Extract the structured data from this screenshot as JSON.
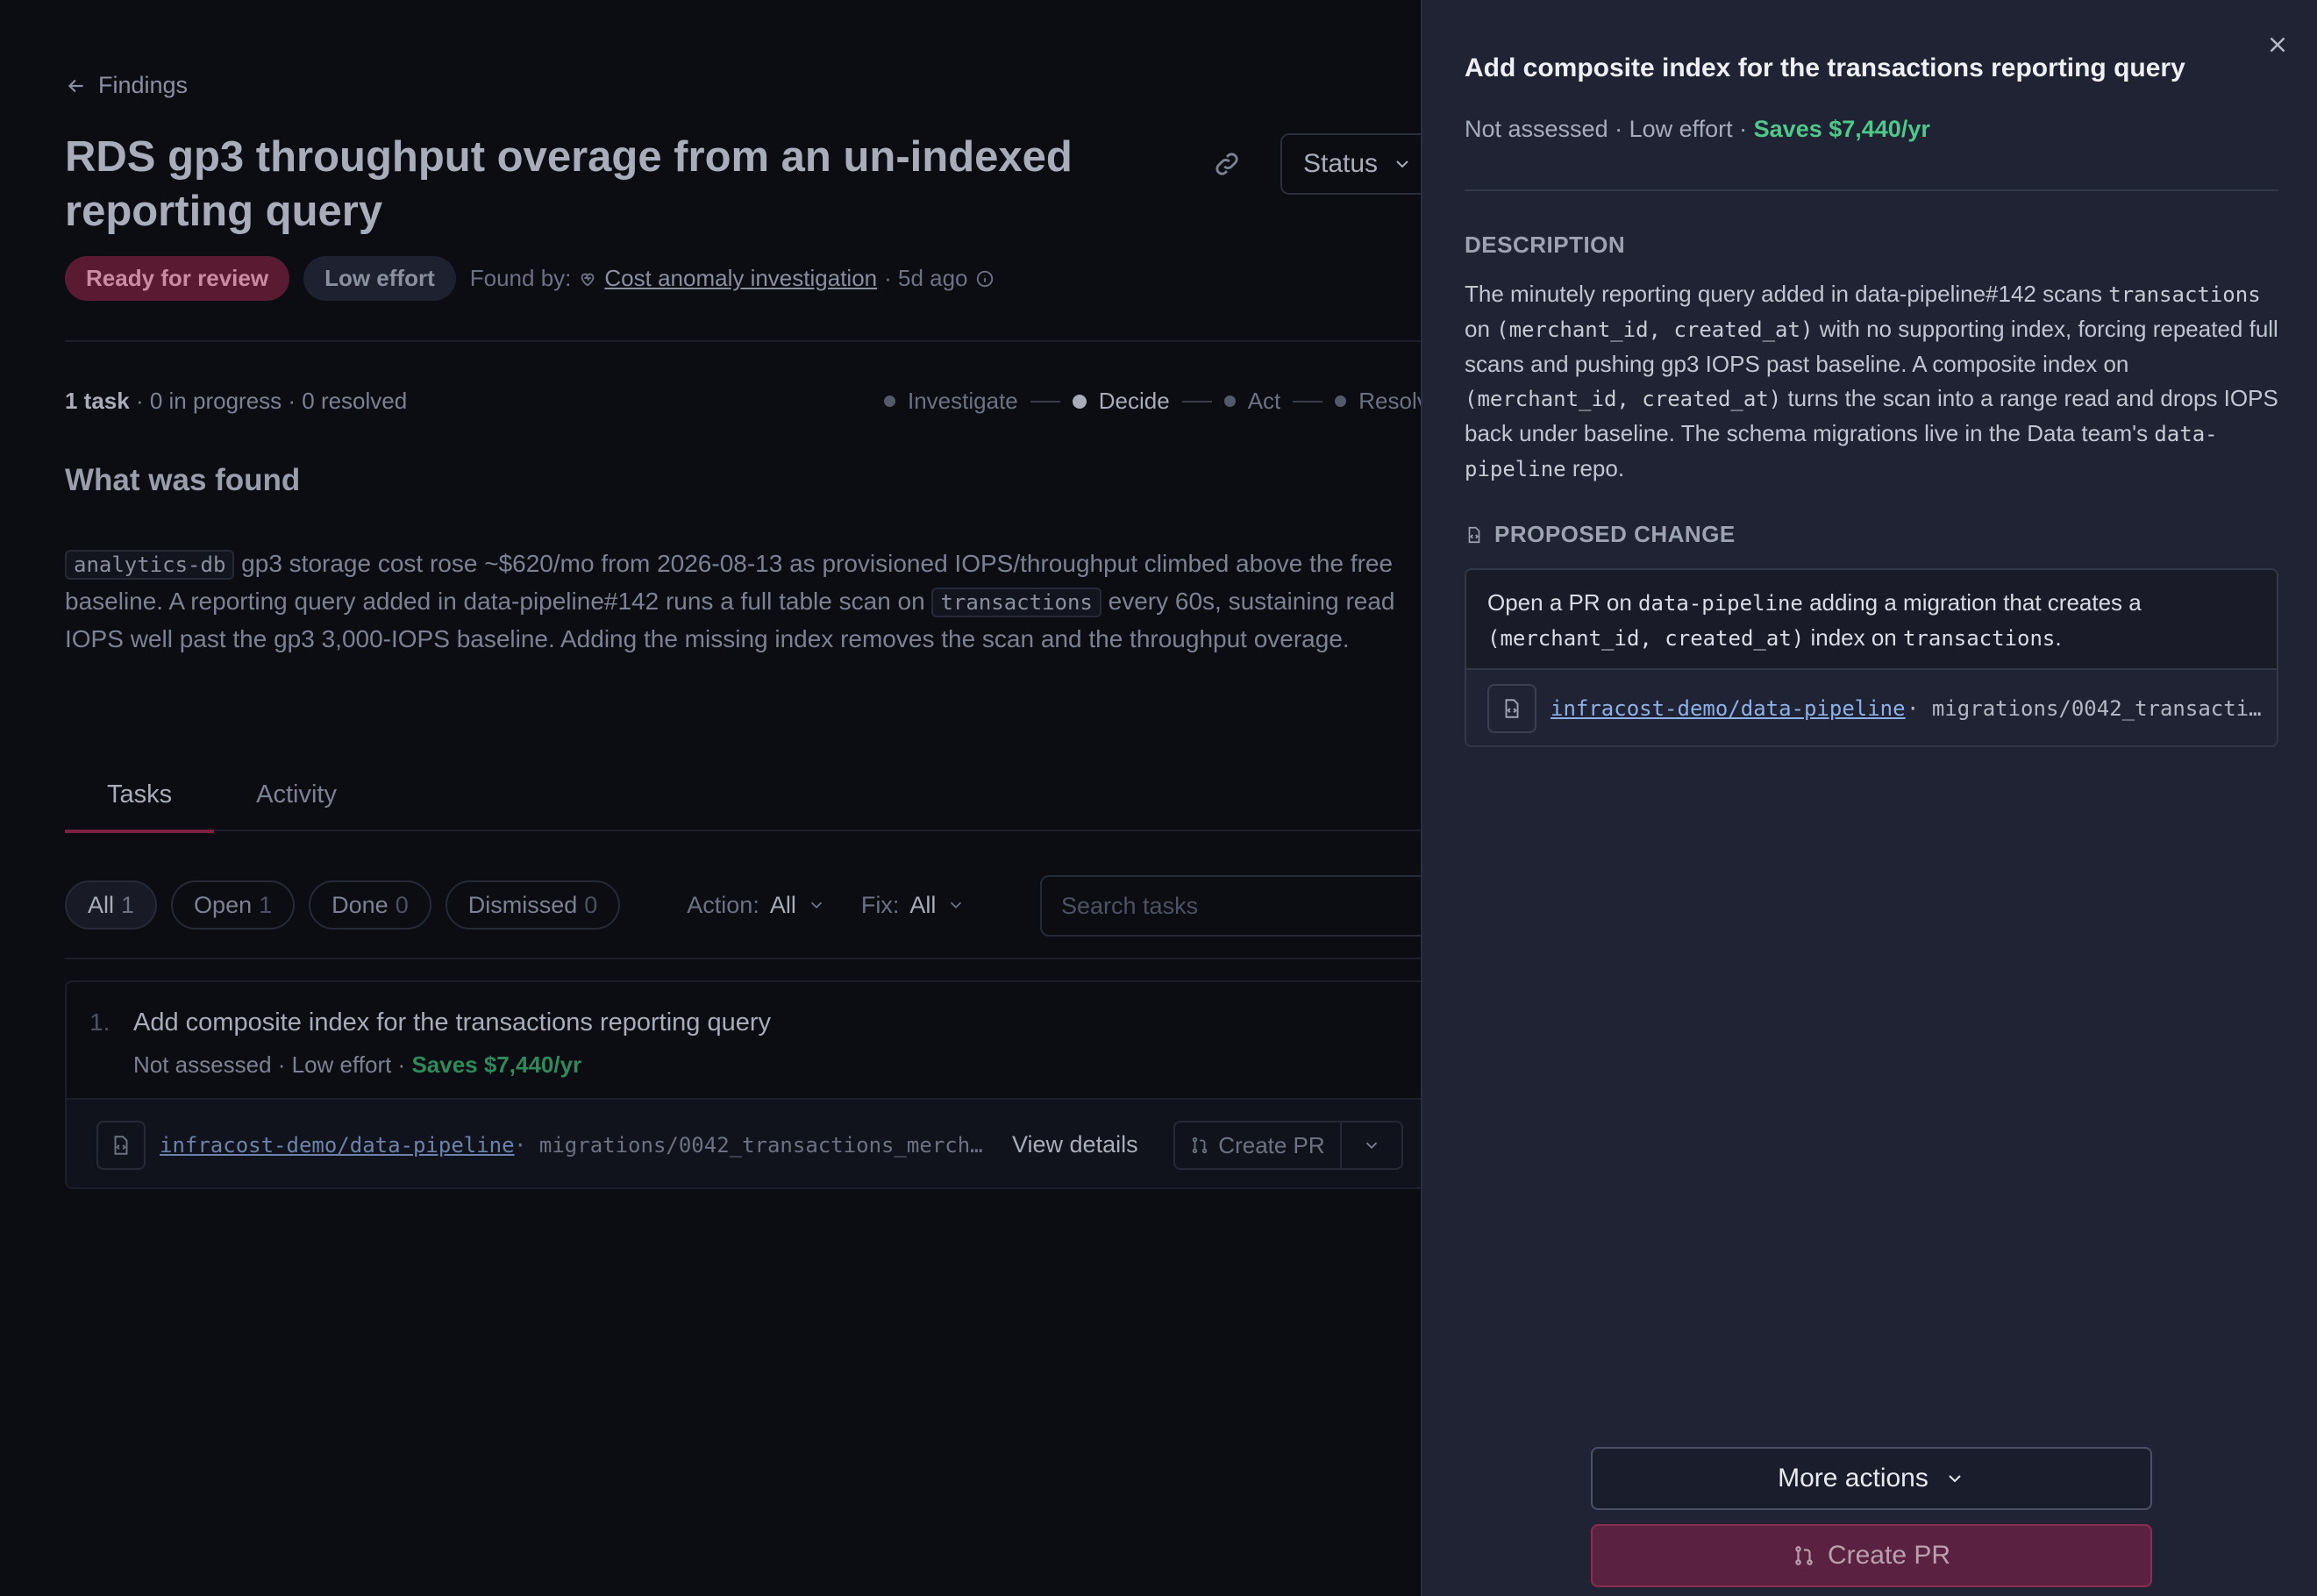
{
  "main": {
    "back_label": "Findings",
    "title": "RDS gp3 throughput overage from an un-indexed reporting query",
    "status_label": "Status",
    "badge_status": "Ready for review",
    "badge_effort": "Low effort",
    "found_by_label": "Found by:",
    "found_by_source": "Cost anomaly investigation",
    "found_age": "· 5d ago",
    "task_count": "1 task",
    "task_progress": "· 0 in progress · 0 resolved",
    "steps": [
      "Investigate",
      "Decide",
      "Act",
      "Resolve"
    ],
    "section_heading": "What was found",
    "summary": {
      "db_chip": "analytics-db",
      "part1": " gp3 storage cost rose ~$620/mo from 2026-08-13 as provisioned IOPS/throughput climbed above the free baseline. A reporting query added in data-pipeline#142 runs a full table scan on ",
      "table_chip": "transactions",
      "part2": " every 60s, sustaining read IOPS well past the gp3 3,000-IOPS baseline. Adding the missing index removes the scan and the throughput overage."
    },
    "tabs": [
      "Tasks",
      "Activity"
    ],
    "filters": [
      {
        "label": "All",
        "count": "1"
      },
      {
        "label": "Open",
        "count": "1"
      },
      {
        "label": "Done",
        "count": "0"
      },
      {
        "label": "Dismissed",
        "count": "0"
      }
    ],
    "action_filter": {
      "label": "Action:",
      "value": "All"
    },
    "fix_filter": {
      "label": "Fix:",
      "value": "All"
    },
    "search_placeholder": "Search tasks",
    "task": {
      "number": "1.",
      "title": "Add composite index for the transactions reporting query",
      "meta": "Not assessed · Low effort · ",
      "saves": "Saves $7,440/yr",
      "repo": "infracost-demo/data-pipeline",
      "path": "· migrations/0042_transactions_merch…",
      "view_details": "View details",
      "create_pr": "Create PR"
    }
  },
  "panel": {
    "title": "Add composite index for the transactions reporting query",
    "meta": "Not assessed · Low effort · ",
    "saves": "Saves $7,440/yr",
    "description_heading": "DESCRIPTION",
    "description": {
      "t1": "The minutely reporting query added in data-pipeline#142 scans ",
      "c1": "transactions",
      "t2": " on ",
      "c2": "(merchant_id, created_at)",
      "t3": " with no supporting index, forcing repeated full scans and pushing gp3 IOPS past baseline. A composite index on ",
      "c3": "(merchant_id, created_at)",
      "t4": " turns the scan into a range read and drops IOPS back under baseline. The schema migrations live in the Data team's ",
      "c4": "data-pipeline",
      "t5": " repo."
    },
    "proposed_heading": "PROPOSED CHANGE",
    "proposed": {
      "t1": "Open a PR on ",
      "c1": "data-pipeline",
      "t2": " adding a migration that creates a ",
      "c2": "(merchant_id, created_at)",
      "t3": " index on ",
      "c3": "transactions",
      "t4": "."
    },
    "repo": "infracost-demo/data-pipeline",
    "path": "· migrations/0042_transacti…",
    "more_actions": "More actions",
    "create_pr": "Create PR"
  },
  "colors": {
    "accent": "#5a2240",
    "saves_green": "#4ec98a",
    "link_blue": "#8fb0e6"
  }
}
